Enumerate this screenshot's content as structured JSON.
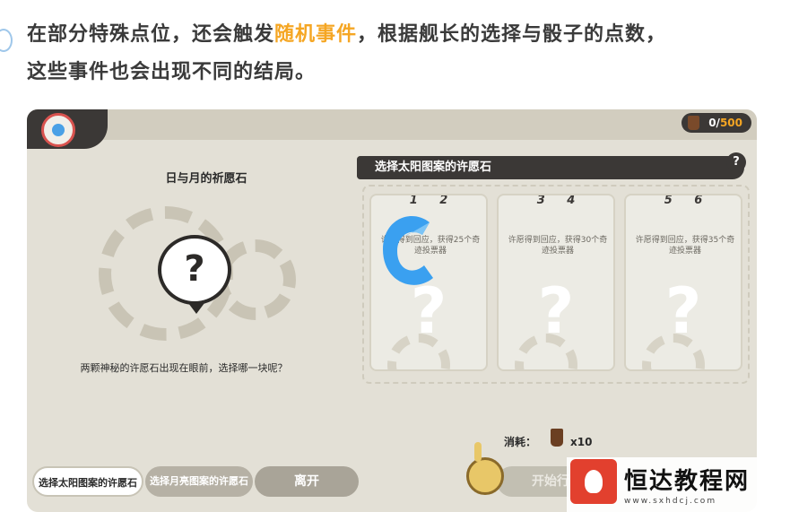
{
  "intro": {
    "line1_pre": "在部分特殊点位，还会触发",
    "line1_highlight": "随机事件",
    "line1_post": "，根据舰长的选择与骰子的点数，",
    "line2": "这些事件也会出现不同的结局。"
  },
  "header": {
    "counter_value": "0/",
    "counter_max": "500"
  },
  "left": {
    "title": "日与月的祈愿石",
    "description": "两颗神秘的许愿石出现在眼前，选择哪一块呢？"
  },
  "choice": {
    "header": "选择太阳图案的许愿石",
    "help": "?",
    "cards": [
      {
        "nums": "1 2",
        "desc": "许愿得到回应，获得25个奇迹投票器",
        "mark": "?"
      },
      {
        "nums": "3 4",
        "desc": "许愿得到回应，获得30个奇迹投票器",
        "mark": "?"
      },
      {
        "nums": "5 6",
        "desc": "许愿得到回应，获得35个奇迹投票器",
        "mark": "?"
      }
    ]
  },
  "cost": {
    "label": "消耗：",
    "value": "x10"
  },
  "buttons": {
    "sun": "选择太阳图案的许愿石",
    "moon": "选择月亮图案的许愿石",
    "leave": "离开",
    "start": "开始行"
  },
  "watermark": {
    "name": "恒达教程网",
    "url": "www.sxhdcj.com"
  },
  "colors": {
    "highlight": "#f5a623",
    "panel": "#e3e0d6",
    "dark": "#3b3836",
    "loader": "#3aa0f0"
  }
}
